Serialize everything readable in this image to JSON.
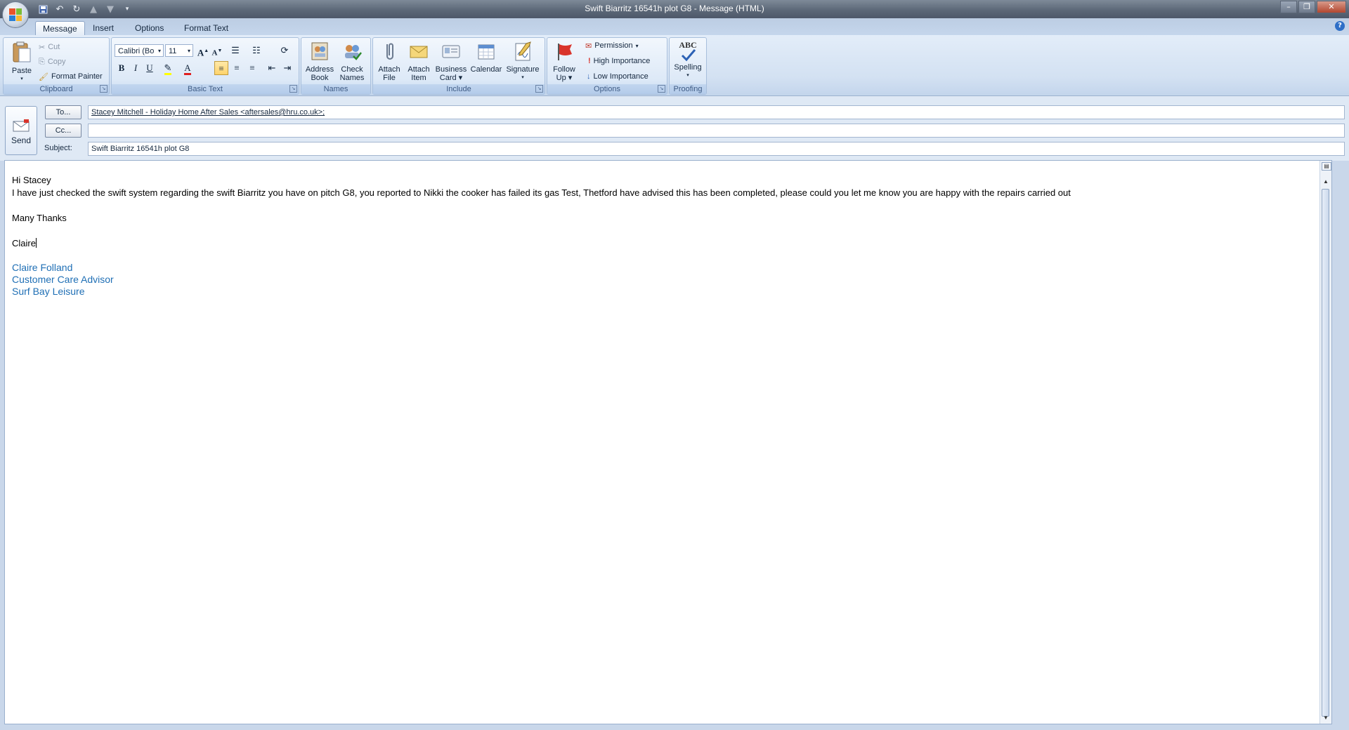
{
  "window": {
    "title": "Swift Biarritz 16541h plot G8 - Message (HTML)",
    "controls": [
      "minimize",
      "restore",
      "close"
    ]
  },
  "tabs": [
    {
      "label": "Message",
      "active": true
    },
    {
      "label": "Insert",
      "active": false
    },
    {
      "label": "Options",
      "active": false
    },
    {
      "label": "Format Text",
      "active": false
    }
  ],
  "ribbon": {
    "clipboard": {
      "label": "Clipboard",
      "paste": "Paste",
      "cut": "Cut",
      "copy": "Copy",
      "format_painter": "Format Painter"
    },
    "basic_text": {
      "label": "Basic Text",
      "font": "Calibri (Bo",
      "size": "11"
    },
    "names": {
      "label": "Names",
      "address_book_1": "Address",
      "address_book_2": "Book",
      "check_names_1": "Check",
      "check_names_2": "Names"
    },
    "include": {
      "label": "Include",
      "attach_file_1": "Attach",
      "attach_file_2": "File",
      "attach_item_1": "Attach",
      "attach_item_2": "Item",
      "business_card_1": "Business",
      "business_card_2": "Card",
      "calendar": "Calendar",
      "signature": "Signature"
    },
    "options": {
      "label": "Options",
      "follow_up_1": "Follow",
      "follow_up_2": "Up",
      "permission": "Permission",
      "high_importance": "High Importance",
      "low_importance": "Low Importance"
    },
    "proofing": {
      "label": "Proofing",
      "spelling": "Spelling",
      "abc": "ABC"
    }
  },
  "envelope": {
    "send": "Send",
    "to_button": "To...",
    "cc_button": "Cc...",
    "subject_label": "Subject:",
    "to_value": "Stacey Mitchell - Holiday Home After Sales <aftersales@hru.co.uk>;",
    "cc_value": "",
    "subject_value": "Swift Biarritz 16541h plot G8"
  },
  "body": {
    "greeting": "Hi Stacey",
    "paragraph": "I have just checked the swift system regarding the swift Biarritz you have on pitch G8, you reported to Nikki the cooker has failed its gas Test, Thetford have advised this has been completed, please could you let me know you are happy with the repairs carried out",
    "closing": "Many Thanks",
    "sign_off": "Claire",
    "signature": {
      "name": "Claire Folland",
      "role": "Customer Care Advisor",
      "company": "Surf Bay Leisure"
    }
  },
  "colors": {
    "signature_text": "#1f6fb5",
    "ribbon_group_label": "#3e5b84"
  }
}
